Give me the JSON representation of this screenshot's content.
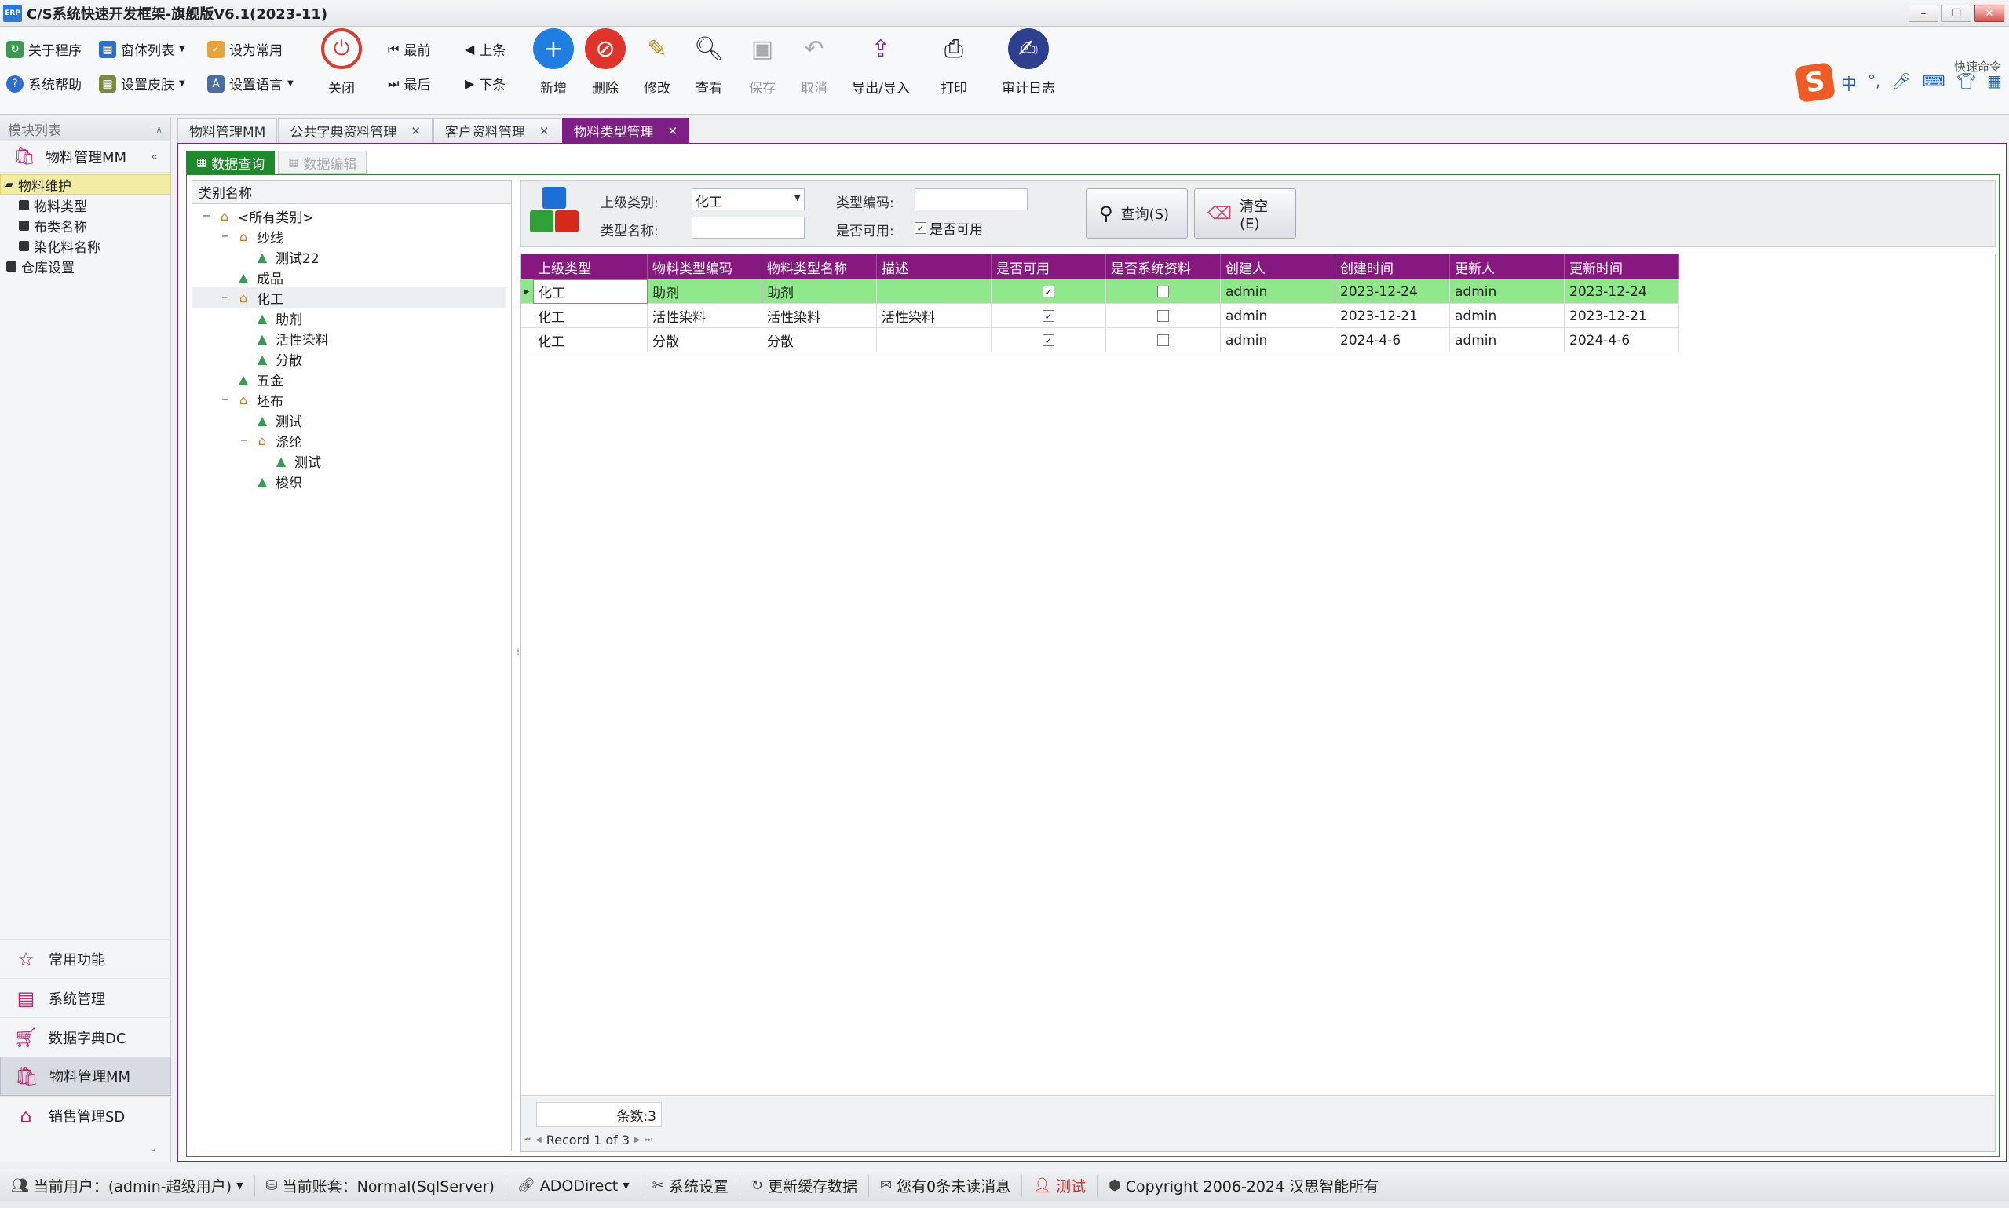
{
  "window": {
    "title": "C/S系统快速开发框架-旗舰版V6.1(2023-11)",
    "app_icon": "ERP"
  },
  "toolbar": {
    "about": "关于程序",
    "window_list": "窗体列表",
    "set_favorite": "设为常用",
    "help": "系统帮助",
    "skin": "设置皮肤",
    "language": "设置语言",
    "close": "关闭",
    "first": "最前",
    "prev": "上条",
    "last": "最后",
    "next": "下条",
    "add": "新增",
    "delete": "删除",
    "edit": "修改",
    "view": "查看",
    "save": "保存",
    "cancel": "取消",
    "export_import": "导出/导入",
    "print": "打印",
    "audit_log": "审计日志"
  },
  "ime": {
    "quick_cmd": "快速命令",
    "lang": "中",
    "punct": "°,"
  },
  "sidebar": {
    "header": "模块列表",
    "module": "物料管理MM",
    "tree": [
      {
        "label": "物料维护",
        "level": 0,
        "selected": true
      },
      {
        "label": "物料类型",
        "level": 1
      },
      {
        "label": "布类名称",
        "level": 1
      },
      {
        "label": "染化料名称",
        "level": 1
      },
      {
        "label": "仓库设置",
        "level": 0
      }
    ],
    "nav": [
      {
        "label": "常用功能"
      },
      {
        "label": "系统管理"
      },
      {
        "label": "数据字典DC"
      },
      {
        "label": "物料管理MM",
        "active": true
      },
      {
        "label": "销售管理SD"
      }
    ]
  },
  "doc_tabs": [
    {
      "label": "物料管理MM"
    },
    {
      "label": "公共字典资料管理"
    },
    {
      "label": "客户资料管理"
    },
    {
      "label": "物料类型管理",
      "active": true
    }
  ],
  "sub_tabs": {
    "query": "数据查询",
    "edit": "数据编辑"
  },
  "tree": {
    "header": "类别名称",
    "nodes": [
      {
        "label": "<所有类别>",
        "level": 0,
        "exp": "-"
      },
      {
        "label": "纱线",
        "level": 1,
        "exp": "-"
      },
      {
        "label": "测试22",
        "level": 2
      },
      {
        "label": "成品",
        "level": 1
      },
      {
        "label": "化工",
        "level": 1,
        "exp": "-",
        "selected": true
      },
      {
        "label": "助剂",
        "level": 2
      },
      {
        "label": "活性染料",
        "level": 2
      },
      {
        "label": "分散",
        "level": 2
      },
      {
        "label": "五金",
        "level": 1
      },
      {
        "label": "坯布",
        "level": 1,
        "exp": "-"
      },
      {
        "label": "测试",
        "level": 2
      },
      {
        "label": "涤纶",
        "level": 2,
        "exp": "-"
      },
      {
        "label": "测试",
        "level": 3
      },
      {
        "label": "梭织",
        "level": 2
      }
    ]
  },
  "query": {
    "parent_label": "上级类别:",
    "parent_value": "化工",
    "code_label": "类型编码:",
    "code_value": "",
    "name_label": "类型名称:",
    "name_value": "",
    "enabled_label": "是否可用:",
    "enabled_check": "是否可用",
    "search_btn": "查询(S)",
    "clear_btn": "清空(E)"
  },
  "grid": {
    "columns": [
      "上级类型",
      "物料类型编码",
      "物料类型名称",
      "描述",
      "是否可用",
      "是否系统资料",
      "创建人",
      "创建时间",
      "更新人",
      "更新时间"
    ],
    "rows": [
      {
        "cells": [
          "化工",
          "助剂",
          "助剂",
          "",
          true,
          false,
          "admin",
          "2023-12-24",
          "admin",
          "2023-12-24"
        ],
        "selected": true
      },
      {
        "cells": [
          "化工",
          "活性染料",
          "活性染料",
          "活性染料",
          true,
          false,
          "admin",
          "2023-12-21",
          "admin",
          "2023-12-21"
        ]
      },
      {
        "cells": [
          "化工",
          "分散",
          "分散",
          "",
          true,
          false,
          "admin",
          "2024-4-6",
          "admin",
          "2024-4-6"
        ]
      }
    ],
    "count_text": "条数:3",
    "record_text": "Record 1 of 3"
  },
  "status": {
    "user": "当前用户：(admin-超级用户)",
    "account": "当前账套：Normal(SqlServer)",
    "conn": "ADODirect",
    "settings": "系统设置",
    "refresh": "更新缓存数据",
    "messages": "您有0条未读消息",
    "test": "测试",
    "copyright": "Copyright 2006-2024 汉思智能所有"
  },
  "colors": {
    "accent_purple": "#86187f",
    "active_green": "#1f8a2c",
    "selected_row": "#8fe98a"
  }
}
